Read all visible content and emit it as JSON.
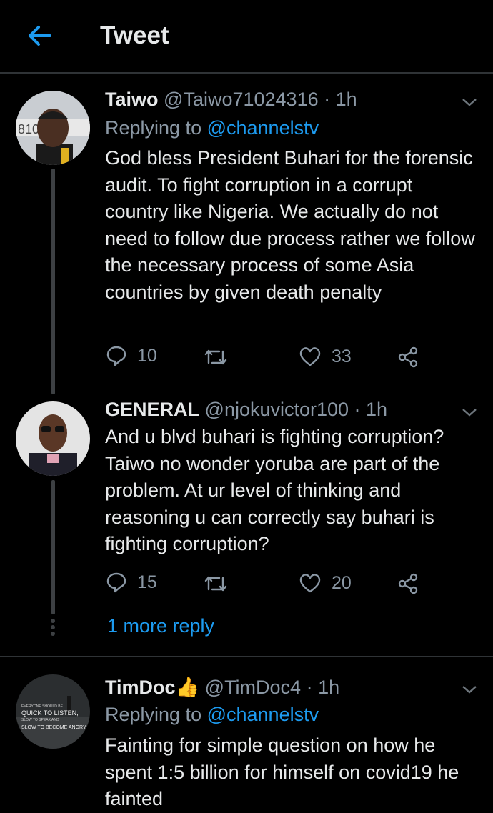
{
  "header": {
    "title": "Tweet"
  },
  "tweets": [
    {
      "name": "Taiwo",
      "handle": "@Taiwo71024316 · 1h",
      "replying_prefix": "Replying to ",
      "replying_to": "@channelstv",
      "text": "God bless President Buhari for the forensic audit. To fight corruption in a corrupt country like Nigeria. We actually do not need to follow due process rather we follow the necessary process of some Asia countries by given death penalty",
      "replies": "10",
      "likes": "33"
    },
    {
      "name": "GENERAL",
      "handle": "@njokuvictor100 · 1h",
      "text": "And u blvd buhari is fighting corruption? Taiwo no wonder yoruba are part of the problem. At ur level of thinking and reasoning u can correctly say buhari is fighting corruption?",
      "replies": "15",
      "likes": "20"
    },
    {
      "name": "TimDoc👍",
      "handle": "@TimDoc4 · 1h",
      "replying_prefix": "Replying to ",
      "replying_to": "@channelstv",
      "text": "Fainting for simple question on how he spent 1:5 billion for himself on covid19 he fainted"
    }
  ],
  "more_replies": "1 more reply",
  "avatar3_text": {
    "line1": "EVERYONE SHOULD BE",
    "line2": "QUICK TO LISTEN,",
    "line3": "SLOW TO SPEAK AND",
    "line4": "SLOW TO BECOME ANGRY"
  },
  "colors": {
    "accent": "#1d9bf0",
    "background": "#000000",
    "secondary_text": "#8b98a5"
  }
}
